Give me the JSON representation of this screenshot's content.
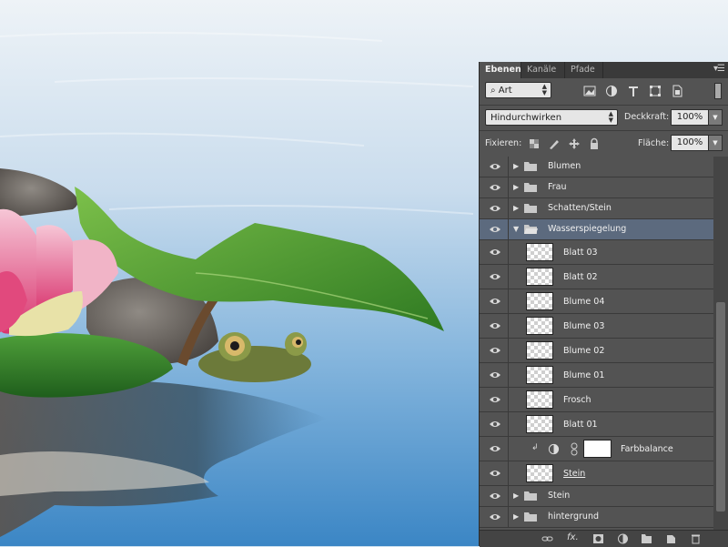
{
  "panel": {
    "tabs": [
      {
        "label": "Ebenen",
        "active": true
      },
      {
        "label": "Kanäle",
        "active": false
      },
      {
        "label": "Pfade",
        "active": false
      }
    ],
    "filter": {
      "value": "Art"
    },
    "blend_mode": {
      "value": "Hindurchwirken"
    },
    "opacity": {
      "label": "Deckkraft:",
      "value": "100%"
    },
    "lock": {
      "label": "Fixieren:"
    },
    "fill": {
      "label": "Fläche:",
      "value": "100%"
    }
  },
  "layers": [
    {
      "name": "Blumen",
      "type": "group",
      "expanded": false
    },
    {
      "name": "Frau",
      "type": "group",
      "expanded": false
    },
    {
      "name": "Schatten/Stein",
      "type": "group",
      "expanded": false
    },
    {
      "name": "Wasserspiegelung",
      "type": "group",
      "expanded": true,
      "selected": true
    },
    {
      "name": "Blatt 03",
      "type": "layer"
    },
    {
      "name": "Blatt 02",
      "type": "layer"
    },
    {
      "name": "Blume 04",
      "type": "layer"
    },
    {
      "name": "Blume 03",
      "type": "layer"
    },
    {
      "name": "Blume 02",
      "type": "layer"
    },
    {
      "name": "Blume 01",
      "type": "layer"
    },
    {
      "name": "Frosch",
      "type": "layer"
    },
    {
      "name": "Blatt 01",
      "type": "layer"
    },
    {
      "name": "Farbbalance",
      "type": "adjustment"
    },
    {
      "name": "Stein",
      "type": "layer"
    },
    {
      "name": "Stein",
      "type": "group",
      "expanded": false
    },
    {
      "name": "hintergrund",
      "type": "group",
      "expanded": false
    }
  ],
  "colors": {
    "panel_bg": "#535353",
    "selected_row": "#5c6a7e",
    "water_top": "#e7eef5",
    "water_bottom": "#3a86c4"
  }
}
